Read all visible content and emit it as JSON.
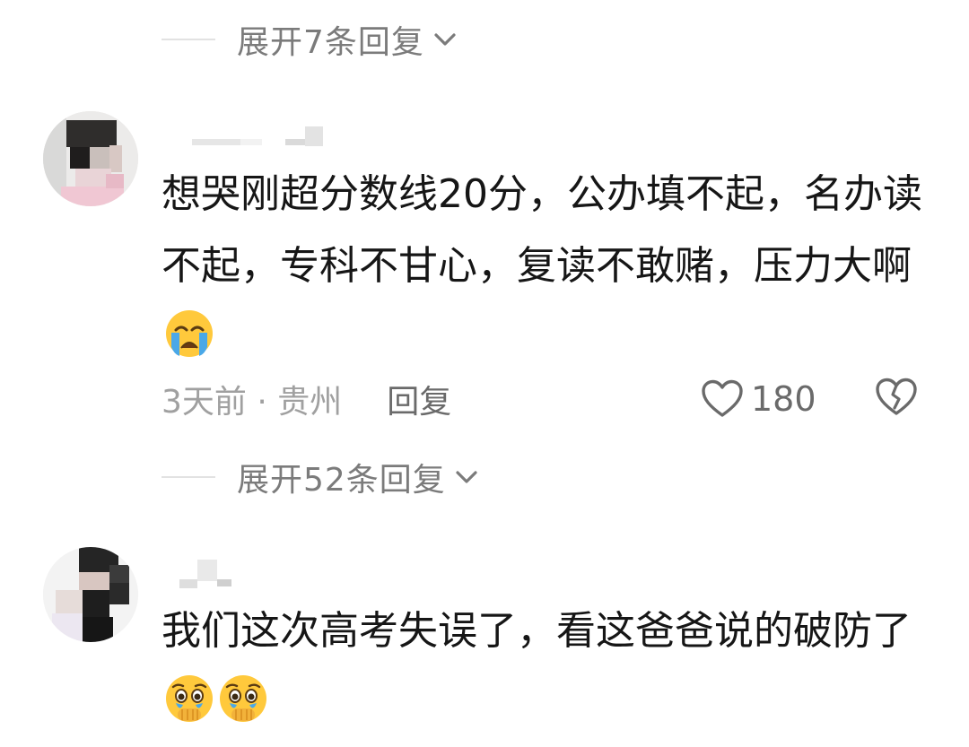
{
  "thread": {
    "top_expand_label": "展开7条回复",
    "comments": [
      {
        "text": "想哭刚超分数线20分，公办填不起，名办读不起，专科不甘心，复读不敢赌，压力大啊",
        "emoji": "loudly-crying-face",
        "meta": "3天前 · 贵州",
        "reply_label": "回复",
        "likes": "180",
        "expand_label": "展开52条回复"
      },
      {
        "text": "我们这次高考失误了，看这爸爸说的破防了",
        "emoji": "face-holding-back-tears"
      }
    ]
  },
  "colors": {
    "background": "#ffffff",
    "text_primary": "#161616",
    "text_secondary": "#7b7b7b",
    "text_muted": "#a0a0a0",
    "emoji_yellow": "#ffc93c",
    "tear_blue": "#4aa8e8"
  }
}
